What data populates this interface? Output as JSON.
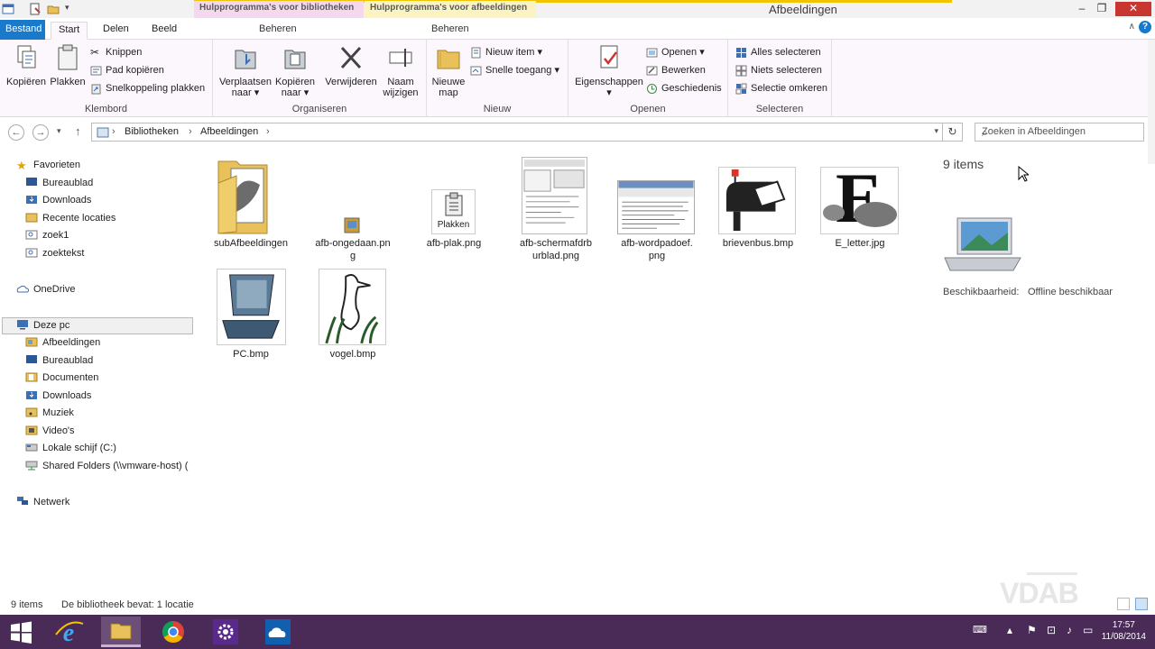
{
  "window": {
    "title": "Afbeeldingen",
    "context_tabs": [
      "Hulpprogramma's voor bibliotheken",
      "Hulpprogramma's voor afbeeldingen"
    ]
  },
  "tabs": {
    "bestand": "Bestand",
    "start": "Start",
    "delen": "Delen",
    "beeld": "Beeld",
    "beheren1": "Beheren",
    "beheren2": "Beheren"
  },
  "ribbon": {
    "klembord": {
      "label": "Klembord",
      "kopieren": "Kopiëren",
      "plakken": "Plakken",
      "knippen": "Knippen",
      "pad_kopieren": "Pad kopiëren",
      "snelkoppeling": "Snelkoppeling plakken"
    },
    "organiseren": {
      "label": "Organiseren",
      "verplaatsen": "Verplaatsen",
      "verplaatsen2": "naar",
      "kopieren": "Kopiëren",
      "kopieren2": "naar",
      "verwijderen": "Verwijderen",
      "naam": "Naam",
      "naam2": "wijzigen"
    },
    "nieuw": {
      "label": "Nieuw",
      "nieuwe": "Nieuwe",
      "map": "map",
      "nieuw_item": "Nieuw item",
      "snelle_toegang": "Snelle toegang"
    },
    "openen": {
      "label": "Openen",
      "eigenschappen": "Eigenschappen",
      "openen": "Openen",
      "bewerken": "Bewerken",
      "geschiedenis": "Geschiedenis"
    },
    "selecteren": {
      "label": "Selecteren",
      "alles": "Alles selecteren",
      "niets": "Niets selecteren",
      "omkeren": "Selectie omkeren"
    }
  },
  "address": {
    "crumb1": "Bibliotheken",
    "crumb2": "Afbeeldingen",
    "search_placeholder": "Zoeken in Afbeeldingen"
  },
  "navpane": {
    "favorieten": "Favorieten",
    "fav_items": [
      "Bureaublad",
      "Downloads",
      "Recente locaties",
      "zoek1",
      "zoektekst"
    ],
    "onedrive": "OneDrive",
    "deze_pc": "Deze pc",
    "pc_items": [
      "Afbeeldingen",
      "Bureaublad",
      "Documenten",
      "Downloads",
      "Muziek",
      "Video's",
      "Lokale schijf (C:)",
      "Shared Folders (\\\\vmware-host) ("
    ],
    "netwerk": "Netwerk"
  },
  "files": [
    {
      "name": "subAfbeeldingen",
      "name2": ""
    },
    {
      "name": "afb-ongedaan.pn",
      "name2": "g"
    },
    {
      "name": "afb-plak.png",
      "name2": "",
      "thumb_text": "Plakken"
    },
    {
      "name": "afb-schermafdrb",
      "name2": "urblad.png"
    },
    {
      "name": "afb-wordpadoef.",
      "name2": "png"
    },
    {
      "name": "brievenbus.bmp",
      "name2": ""
    },
    {
      "name": "E_letter.jpg",
      "name2": "",
      "thumb_text": "E"
    },
    {
      "name": "PC.bmp",
      "name2": ""
    },
    {
      "name": "vogel.bmp",
      "name2": ""
    }
  ],
  "details": {
    "count": "9 items",
    "avail_label": "Beschikbaarheid:",
    "avail_value": "Offline beschikbaar"
  },
  "status": {
    "count": "9 items",
    "info": "De bibliotheek bevat: 1 locatie",
    "watermark": "VDAB"
  },
  "taskbar": {
    "time": "17:57",
    "date": "11/08/2014"
  }
}
